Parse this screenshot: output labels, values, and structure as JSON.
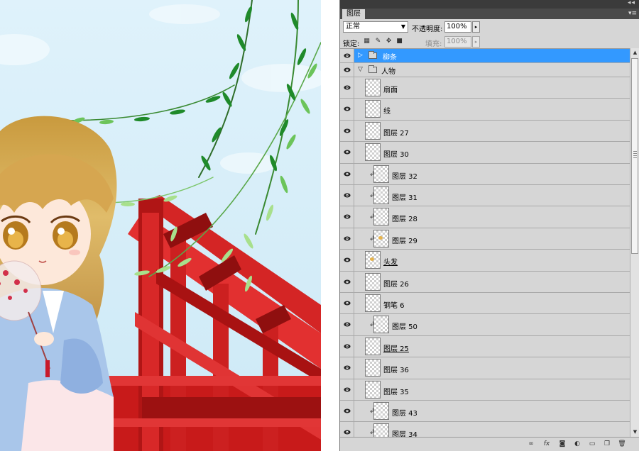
{
  "panel": {
    "tab_label": "图层",
    "title_arrows": "◂◂",
    "menu_icon": "panel-menu-icon",
    "blend_mode": "正常",
    "opacity_label": "不透明度:",
    "opacity_value": "100%",
    "lock_label": "锁定:",
    "fill_label": "填充:",
    "fill_value": "100%"
  },
  "layers": [
    {
      "name": "柳条",
      "kind": "group",
      "expanded": false,
      "selected": true,
      "indent": 0
    },
    {
      "name": "人物",
      "kind": "group",
      "expanded": true,
      "selected": false,
      "indent": 0
    },
    {
      "name": "扇面",
      "kind": "layer",
      "clipped": false
    },
    {
      "name": "线",
      "kind": "layer",
      "clipped": false
    },
    {
      "name": "图层 27",
      "kind": "layer",
      "clipped": false
    },
    {
      "name": "图层 30",
      "kind": "layer",
      "clipped": false
    },
    {
      "name": "图层 32",
      "kind": "layer",
      "clipped": true
    },
    {
      "name": "图层 31",
      "kind": "layer",
      "clipped": true
    },
    {
      "name": "图层 28",
      "kind": "layer",
      "clipped": true
    },
    {
      "name": "图层 29",
      "kind": "layer",
      "clipped": true
    },
    {
      "name": "头发",
      "kind": "layer",
      "clipped": false
    },
    {
      "name": "图层 26",
      "kind": "layer",
      "clipped": false
    },
    {
      "name": "钢笔 6",
      "kind": "layer",
      "clipped": false
    },
    {
      "name": "图层 50",
      "kind": "layer",
      "clipped": true
    },
    {
      "name": "图层 25",
      "kind": "layer",
      "clipped": false
    },
    {
      "name": "图层 36",
      "kind": "layer",
      "clipped": false
    },
    {
      "name": "图层 35",
      "kind": "layer",
      "clipped": false
    },
    {
      "name": "图层 43",
      "kind": "layer",
      "clipped": true
    },
    {
      "name": "图层 34",
      "kind": "layer",
      "clipped": true
    }
  ],
  "bottom_icons": [
    "link-icon",
    "fx-icon",
    "mask-icon",
    "adjustment-icon",
    "new-group-icon",
    "new-layer-icon",
    "trash-icon"
  ],
  "colors": {
    "selection": "#3399ff",
    "panel_bg": "#d6d6d6",
    "sky": "#d6eef9",
    "railing": "#d11f1f"
  }
}
